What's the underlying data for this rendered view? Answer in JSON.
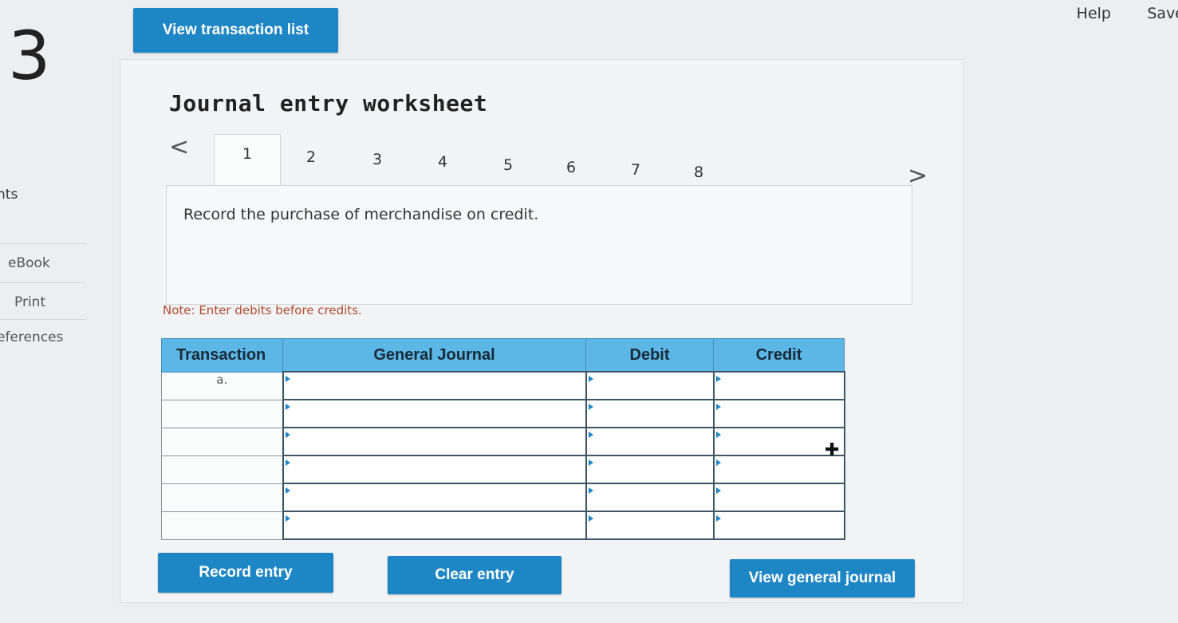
{
  "header": {
    "help": "Help",
    "save": "Save"
  },
  "question_number": "3",
  "left_rail": {
    "points_label": "nts",
    "ebook": "eBook",
    "print": "Print",
    "references": "eferences"
  },
  "buttons": {
    "view_transaction_list": "View transaction list",
    "record_entry": "Record entry",
    "clear_entry": "Clear entry",
    "view_general_journal": "View general journal"
  },
  "worksheet": {
    "title": "Journal entry worksheet",
    "tabs": [
      "1",
      "2",
      "3",
      "4",
      "5",
      "6",
      "7",
      "8"
    ],
    "active_tab": "1",
    "prev_icon": "<",
    "next_icon": ">",
    "description": "Record the purchase of merchandise on credit.",
    "note": "Note: Enter debits before credits."
  },
  "journal_table": {
    "headers": {
      "transaction": "Transaction",
      "general_journal": "General Journal",
      "debit": "Debit",
      "credit": "Credit"
    },
    "rows": [
      {
        "transaction": "a.",
        "account": "",
        "debit": "",
        "credit": ""
      },
      {
        "transaction": "",
        "account": "",
        "debit": "",
        "credit": ""
      },
      {
        "transaction": "",
        "account": "",
        "debit": "",
        "credit": ""
      },
      {
        "transaction": "",
        "account": "",
        "debit": "",
        "credit": ""
      },
      {
        "transaction": "",
        "account": "",
        "debit": "",
        "credit": ""
      },
      {
        "transaction": "",
        "account": "",
        "debit": "",
        "credit": ""
      }
    ]
  },
  "colors": {
    "button_blue": "#1f86c6",
    "header_blue": "#5cb6e6",
    "note_red": "#b24a2f"
  }
}
